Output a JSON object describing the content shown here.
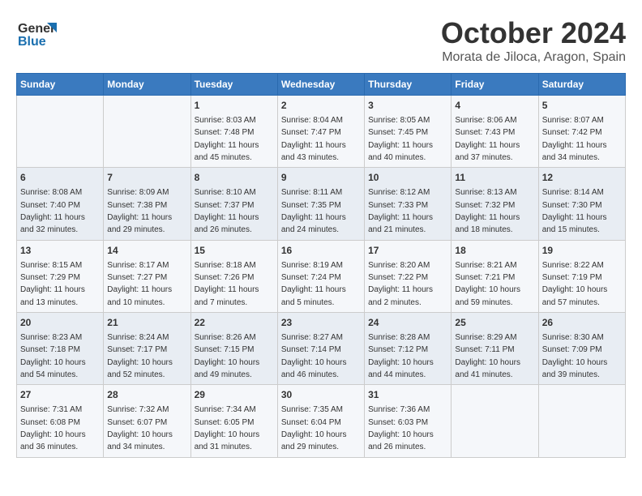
{
  "header": {
    "logo_line1": "General",
    "logo_line2": "Blue",
    "title": "October 2024",
    "subtitle": "Morata de Jiloca, Aragon, Spain"
  },
  "weekdays": [
    "Sunday",
    "Monday",
    "Tuesday",
    "Wednesday",
    "Thursday",
    "Friday",
    "Saturday"
  ],
  "weeks": [
    [
      {
        "day": "",
        "info": ""
      },
      {
        "day": "",
        "info": ""
      },
      {
        "day": "1",
        "info": "Sunrise: 8:03 AM\nSunset: 7:48 PM\nDaylight: 11 hours and 45 minutes."
      },
      {
        "day": "2",
        "info": "Sunrise: 8:04 AM\nSunset: 7:47 PM\nDaylight: 11 hours and 43 minutes."
      },
      {
        "day": "3",
        "info": "Sunrise: 8:05 AM\nSunset: 7:45 PM\nDaylight: 11 hours and 40 minutes."
      },
      {
        "day": "4",
        "info": "Sunrise: 8:06 AM\nSunset: 7:43 PM\nDaylight: 11 hours and 37 minutes."
      },
      {
        "day": "5",
        "info": "Sunrise: 8:07 AM\nSunset: 7:42 PM\nDaylight: 11 hours and 34 minutes."
      }
    ],
    [
      {
        "day": "6",
        "info": "Sunrise: 8:08 AM\nSunset: 7:40 PM\nDaylight: 11 hours and 32 minutes."
      },
      {
        "day": "7",
        "info": "Sunrise: 8:09 AM\nSunset: 7:38 PM\nDaylight: 11 hours and 29 minutes."
      },
      {
        "day": "8",
        "info": "Sunrise: 8:10 AM\nSunset: 7:37 PM\nDaylight: 11 hours and 26 minutes."
      },
      {
        "day": "9",
        "info": "Sunrise: 8:11 AM\nSunset: 7:35 PM\nDaylight: 11 hours and 24 minutes."
      },
      {
        "day": "10",
        "info": "Sunrise: 8:12 AM\nSunset: 7:33 PM\nDaylight: 11 hours and 21 minutes."
      },
      {
        "day": "11",
        "info": "Sunrise: 8:13 AM\nSunset: 7:32 PM\nDaylight: 11 hours and 18 minutes."
      },
      {
        "day": "12",
        "info": "Sunrise: 8:14 AM\nSunset: 7:30 PM\nDaylight: 11 hours and 15 minutes."
      }
    ],
    [
      {
        "day": "13",
        "info": "Sunrise: 8:15 AM\nSunset: 7:29 PM\nDaylight: 11 hours and 13 minutes."
      },
      {
        "day": "14",
        "info": "Sunrise: 8:17 AM\nSunset: 7:27 PM\nDaylight: 11 hours and 10 minutes."
      },
      {
        "day": "15",
        "info": "Sunrise: 8:18 AM\nSunset: 7:26 PM\nDaylight: 11 hours and 7 minutes."
      },
      {
        "day": "16",
        "info": "Sunrise: 8:19 AM\nSunset: 7:24 PM\nDaylight: 11 hours and 5 minutes."
      },
      {
        "day": "17",
        "info": "Sunrise: 8:20 AM\nSunset: 7:22 PM\nDaylight: 11 hours and 2 minutes."
      },
      {
        "day": "18",
        "info": "Sunrise: 8:21 AM\nSunset: 7:21 PM\nDaylight: 10 hours and 59 minutes."
      },
      {
        "day": "19",
        "info": "Sunrise: 8:22 AM\nSunset: 7:19 PM\nDaylight: 10 hours and 57 minutes."
      }
    ],
    [
      {
        "day": "20",
        "info": "Sunrise: 8:23 AM\nSunset: 7:18 PM\nDaylight: 10 hours and 54 minutes."
      },
      {
        "day": "21",
        "info": "Sunrise: 8:24 AM\nSunset: 7:17 PM\nDaylight: 10 hours and 52 minutes."
      },
      {
        "day": "22",
        "info": "Sunrise: 8:26 AM\nSunset: 7:15 PM\nDaylight: 10 hours and 49 minutes."
      },
      {
        "day": "23",
        "info": "Sunrise: 8:27 AM\nSunset: 7:14 PM\nDaylight: 10 hours and 46 minutes."
      },
      {
        "day": "24",
        "info": "Sunrise: 8:28 AM\nSunset: 7:12 PM\nDaylight: 10 hours and 44 minutes."
      },
      {
        "day": "25",
        "info": "Sunrise: 8:29 AM\nSunset: 7:11 PM\nDaylight: 10 hours and 41 minutes."
      },
      {
        "day": "26",
        "info": "Sunrise: 8:30 AM\nSunset: 7:09 PM\nDaylight: 10 hours and 39 minutes."
      }
    ],
    [
      {
        "day": "27",
        "info": "Sunrise: 7:31 AM\nSunset: 6:08 PM\nDaylight: 10 hours and 36 minutes."
      },
      {
        "day": "28",
        "info": "Sunrise: 7:32 AM\nSunset: 6:07 PM\nDaylight: 10 hours and 34 minutes."
      },
      {
        "day": "29",
        "info": "Sunrise: 7:34 AM\nSunset: 6:05 PM\nDaylight: 10 hours and 31 minutes."
      },
      {
        "day": "30",
        "info": "Sunrise: 7:35 AM\nSunset: 6:04 PM\nDaylight: 10 hours and 29 minutes."
      },
      {
        "day": "31",
        "info": "Sunrise: 7:36 AM\nSunset: 6:03 PM\nDaylight: 10 hours and 26 minutes."
      },
      {
        "day": "",
        "info": ""
      },
      {
        "day": "",
        "info": ""
      }
    ]
  ]
}
